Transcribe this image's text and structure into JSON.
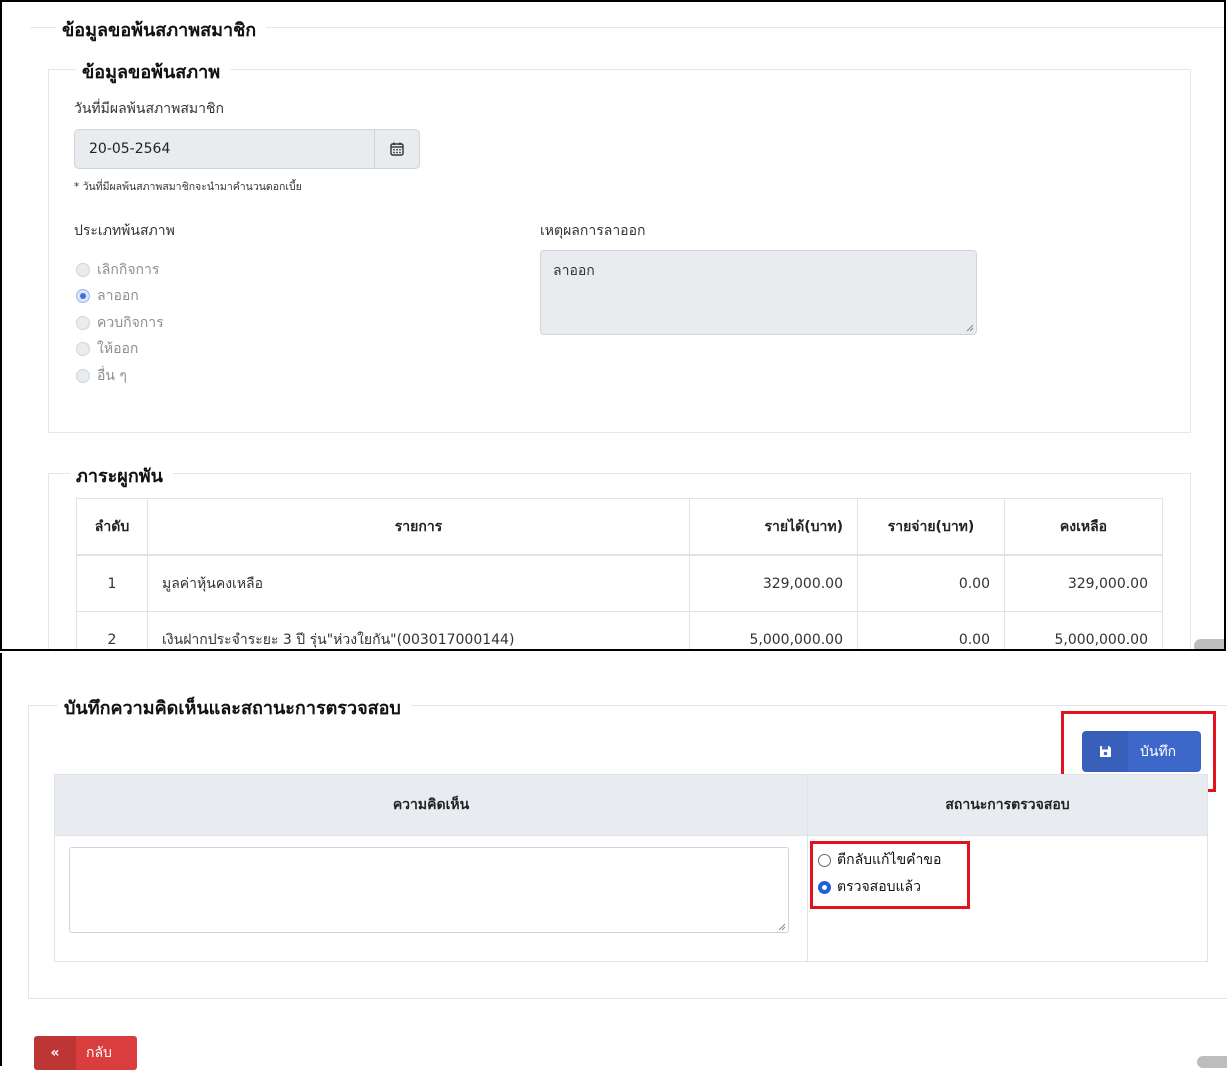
{
  "member_status": {
    "title": "ข้อมูลขอพ้นสภาพสมาชิก",
    "request": {
      "title": "ข้อมูลขอพ้นสภาพ",
      "effective_date_label": "วันที่มีผลพ้นสภาพสมาชิก",
      "effective_date_value": "20-05-2564",
      "effective_date_note": "* วันที่มีผลพ้นสภาพสมาชิกจะนำมาคำนวนดอกเบี้ย",
      "type_label": "ประเภทพ้นสภาพ",
      "types": [
        {
          "label": "เลิกกิจการ",
          "selected": false
        },
        {
          "label": "ลาออก",
          "selected": true
        },
        {
          "label": "ควบกิจการ",
          "selected": false
        },
        {
          "label": "ให้ออก",
          "selected": false
        },
        {
          "label": "อื่น ๆ",
          "selected": false
        }
      ],
      "reason_label": "เหตุผลการลาออก",
      "reason_value": "ลาออก"
    },
    "obligations": {
      "title": "ภาระผูกพัน",
      "columns": [
        "ลำดับ",
        "รายการ",
        "รายได้(บาท)",
        "รายจ่าย(บาท)",
        "คงเหลือ"
      ],
      "rows": [
        {
          "no": "1",
          "item": "มูลค่าหุ้นคงเหลือ",
          "income": "329,000.00",
          "expense": "0.00",
          "balance": "329,000.00"
        },
        {
          "no": "2",
          "item": "เงินฝากประจำระยะ 3 ปี รุ่น\"ห่วงใยกัน\"(003017000144)",
          "income": "5,000,000.00",
          "expense": "0.00",
          "balance": "5,000,000.00"
        }
      ]
    }
  },
  "review": {
    "title": "บันทึกความคิดเห็นและสถานะการตรวจสอบ",
    "save_label": "บันทึก",
    "comment_header": "ความคิดเห็น",
    "status_header": "สถานะการตรวจสอบ",
    "comment_value": "",
    "statuses": [
      {
        "label": "ตีกลับแก้ไขคำขอ",
        "selected": false
      },
      {
        "label": "ตรวจสอบแล้ว",
        "selected": true
      }
    ]
  },
  "back_label": "กลับ",
  "colors": {
    "primary": "#3d68c9",
    "danger": "#d93d3d",
    "highlight": "#e0141e",
    "radio_checked": "#1a62d6"
  },
  "icons": {
    "date": "calendar-icon",
    "save": "save-icon",
    "back": "double-chevron-left-icon"
  }
}
